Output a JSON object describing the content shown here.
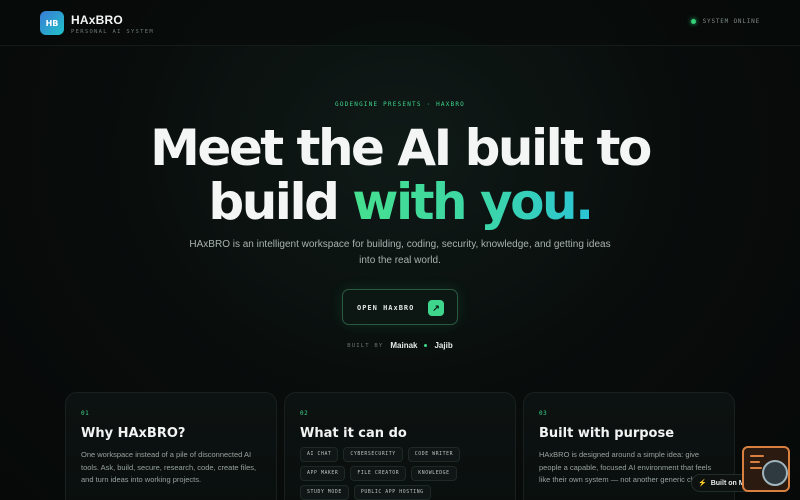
{
  "header": {
    "logo_initials": "HB",
    "brand_name": "HAxBRO",
    "brand_subtitle": "PERSONAL AI SYSTEM",
    "status_text": "SYSTEM ONLINE",
    "status_color": "#33d17a"
  },
  "hero": {
    "eyebrow": "GODENGINE PRESENTS · HAXBRO",
    "headline_line1": "Meet the AI built to",
    "headline_line2_plain": "build ",
    "headline_line2_accent": "with you.",
    "subtitle": "HAxBRO is an intelligent workspace for building, coding, security, knowledge, and getting ideas into the real world.",
    "cta_label": "OPEN HAxBRO",
    "cta_icon": "arrow-up-right-icon",
    "built_by_label": "BUILT BY",
    "builders": [
      "Mainak",
      "Jajib"
    ],
    "accent_color": "#3dd68c"
  },
  "cards": [
    {
      "number": "01",
      "title": "Why HAxBRO?",
      "body": "One workspace instead of a pile of disconnected AI tools. Ask, build, secure, research, code, create files, and turn ideas into working projects."
    },
    {
      "number": "02",
      "title": "What it can do",
      "tags": [
        "AI CHAT",
        "CYBERSECURITY",
        "CODE WRITER",
        "APP MAKER",
        "FILE CREATOR",
        "KNOWLEDGE",
        "STUDY MODE",
        "PUBLIC APP HOSTING"
      ]
    },
    {
      "number": "03",
      "title": "Built with purpose",
      "body": "HAxBRO is designed around a simple idea: give people a capable, focused AI environment that feels like their own system — not another generic chatbot."
    }
  ],
  "floating_badge": {
    "icon": "lightning-icon",
    "label": "Built on Matcha"
  }
}
